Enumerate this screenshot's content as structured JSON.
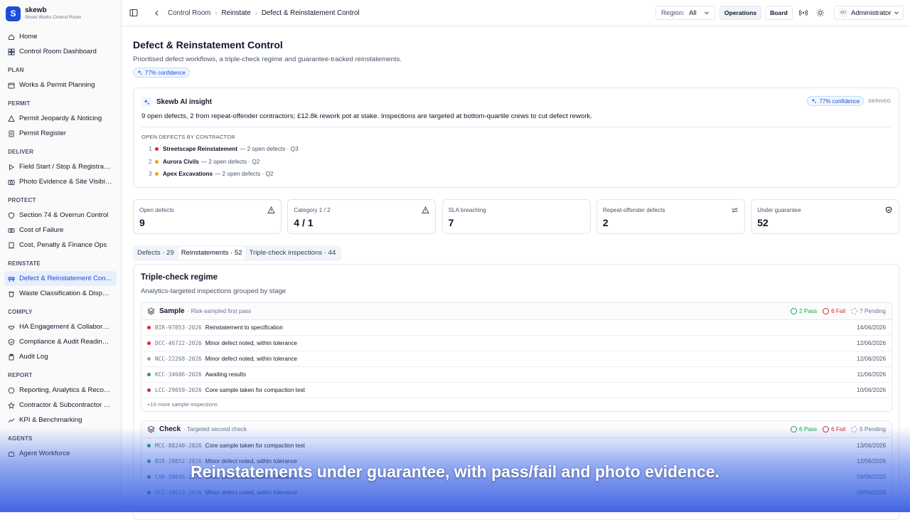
{
  "brand": {
    "logo_letter": "S",
    "name": "skewb",
    "subtitle": "Street Works Control Room"
  },
  "sidebar": {
    "top_items": [
      {
        "label": "Home",
        "icon": "home-icon"
      },
      {
        "label": "Control Room Dashboard",
        "icon": "dashboard-icon"
      }
    ],
    "sections": [
      {
        "title": "PLAN",
        "items": [
          {
            "label": "Works & Permit Planning",
            "icon": "calendar-icon"
          }
        ]
      },
      {
        "title": "PERMIT",
        "items": [
          {
            "label": "Permit Jeopardy & Noticing",
            "icon": "alert-icon"
          },
          {
            "label": "Permit Register",
            "icon": "document-icon"
          }
        ]
      },
      {
        "title": "DELIVER",
        "items": [
          {
            "label": "Field Start / Stop & Registrati...",
            "icon": "play-icon"
          },
          {
            "label": "Photo Evidence & Site Visibility",
            "icon": "camera-icon"
          }
        ]
      },
      {
        "title": "PROTECT",
        "items": [
          {
            "label": "Section 74 & Overrun Control",
            "icon": "shield-icon"
          },
          {
            "label": "Cost of Failure",
            "icon": "cash-icon"
          },
          {
            "label": "Cost, Penalty & Finance Ops",
            "icon": "receipt-icon"
          }
        ]
      },
      {
        "title": "REINSTATE",
        "items": [
          {
            "label": "Defect & Reinstatement Con...",
            "icon": "barrier-icon",
            "active": true
          },
          {
            "label": "Waste Classification & Dispos...",
            "icon": "trash-icon"
          }
        ]
      },
      {
        "title": "COMPLY",
        "items": [
          {
            "label": "HA Engagement & Collaborati...",
            "icon": "handshake-icon"
          },
          {
            "label": "Compliance & Audit Readiness",
            "icon": "shield-check-icon"
          },
          {
            "label": "Audit Log",
            "icon": "clipboard-icon"
          }
        ]
      },
      {
        "title": "REPORT",
        "items": [
          {
            "label": "Reporting, Analytics & Records",
            "icon": "circle-icon"
          },
          {
            "label": "Contractor & Subcontractor P...",
            "icon": "star-icon"
          },
          {
            "label": "KPI & Benchmarking",
            "icon": "trend-icon"
          }
        ]
      },
      {
        "title": "AGENTS",
        "items": [
          {
            "label": "Agent Workforce",
            "icon": "bot-icon"
          }
        ]
      }
    ]
  },
  "topbar": {
    "breadcrumbs": [
      "Control Room",
      "Reinstate",
      "Defect & Reinstatement Control"
    ],
    "region_label": "Region:",
    "region_value": "All",
    "operations_label": "Operations",
    "board_label": "Board",
    "avatar_initials": "AD",
    "user_name": "Administrator"
  },
  "page": {
    "title": "Defect & Reinstatement Control",
    "subtitle": "Prioritised defect workflows, a triple-check regime and guarantee-tracked reinstatements.",
    "confidence": "77% confidence"
  },
  "insight": {
    "title": "Skewb AI insight",
    "confidence": "77% confidence",
    "derived": "DERIVED",
    "text": "9 open defects, 2 from repeat-offender contractors; £12.8k rework pot at stake. Inspections are targeted at bottom-quartile crews to cut defect rework.",
    "list_label": "OPEN DEFECTS BY CONTRACTOR",
    "contractors": [
      {
        "rank": "1",
        "name": "Streetscape Reinstatement",
        "detail": "— 2 open defects · Q3",
        "color": "#dc2626"
      },
      {
        "rank": "2",
        "name": "Aurora Civils",
        "detail": "— 2 open defects · Q2",
        "color": "#f59e0b"
      },
      {
        "rank": "3",
        "name": "Apex Excavations",
        "detail": "— 2 open defects · Q2",
        "color": "#f59e0b"
      }
    ]
  },
  "kpis": [
    {
      "label": "Open defects",
      "value": "9",
      "icon": "warning-icon"
    },
    {
      "label": "Category 1 / 2",
      "value": "4 / 1",
      "icon": "warning-icon"
    },
    {
      "label": "SLA breaching",
      "value": "7",
      "icon": ""
    },
    {
      "label": "Repeat-offender defects",
      "value": "2",
      "icon": "repeat-icon"
    },
    {
      "label": "Under guarantee",
      "value": "52",
      "icon": "shield-check-icon"
    }
  ],
  "tabs": [
    "Defects · 29",
    "Reinstatements · 52",
    "Triple-check inspections · 44"
  ],
  "panel": {
    "title": "Triple-check regime",
    "subtitle": "Analytics-targeted inspections grouped by stage",
    "stages": [
      {
        "name": "Sample",
        "desc": "· Risk-sampled first pass",
        "pass": "2 Pass",
        "fail": "6 Fail",
        "pending": "7 Pending",
        "rows": [
          {
            "ref": "BIR-97053-2026",
            "desc": "Reinstatement to specification",
            "date": "14/06/2026",
            "color": "#dc2626"
          },
          {
            "ref": "DCC-46722-2026",
            "desc": "Minor defect noted, within tolerance",
            "date": "12/06/2026",
            "color": "#dc2626"
          },
          {
            "ref": "NCC-22268-2026",
            "desc": "Minor defect noted, within tolerance",
            "date": "12/06/2026",
            "color": "#94a3b8"
          },
          {
            "ref": "KCC-34606-2026",
            "desc": "Awaiting results",
            "date": "11/06/2026",
            "color": "#16a34a"
          },
          {
            "ref": "LCC-29659-2026",
            "desc": "Core sample taken for compaction test",
            "date": "10/06/2026",
            "color": "#dc2626"
          }
        ],
        "more": "+10 more sample inspections"
      },
      {
        "name": "Check",
        "desc": "· Targeted second check",
        "pass": "6 Pass",
        "fail": "6 Fail",
        "pending": "5 Pending",
        "rows": [
          {
            "ref": "MCC-88240-2026",
            "desc": "Core sample taken for compaction test",
            "date": "13/06/2026",
            "color": "#16a34a"
          },
          {
            "ref": "BIR-20852-2026",
            "desc": "Minor defect noted, within tolerance",
            "date": "12/06/2026",
            "color": "#16a34a"
          },
          {
            "ref": "CAR-58046-2026",
            "desc": "Minor defect noted, within tolerance",
            "date": "09/06/2026",
            "color": "#16a34a"
          },
          {
            "ref": "DCC-34633-2026",
            "desc": "Minor defect noted, within tolerance",
            "date": "09/06/2026",
            "color": "#16a34a"
          }
        ],
        "more": ""
      }
    ]
  },
  "caption": "Reinstatements under guarantee, with pass/fail and photo evidence.",
  "colors": {
    "accent": "#1d4ed8",
    "pass": "#16a34a",
    "fail": "#dc2626",
    "pending": "#94a3b8"
  }
}
